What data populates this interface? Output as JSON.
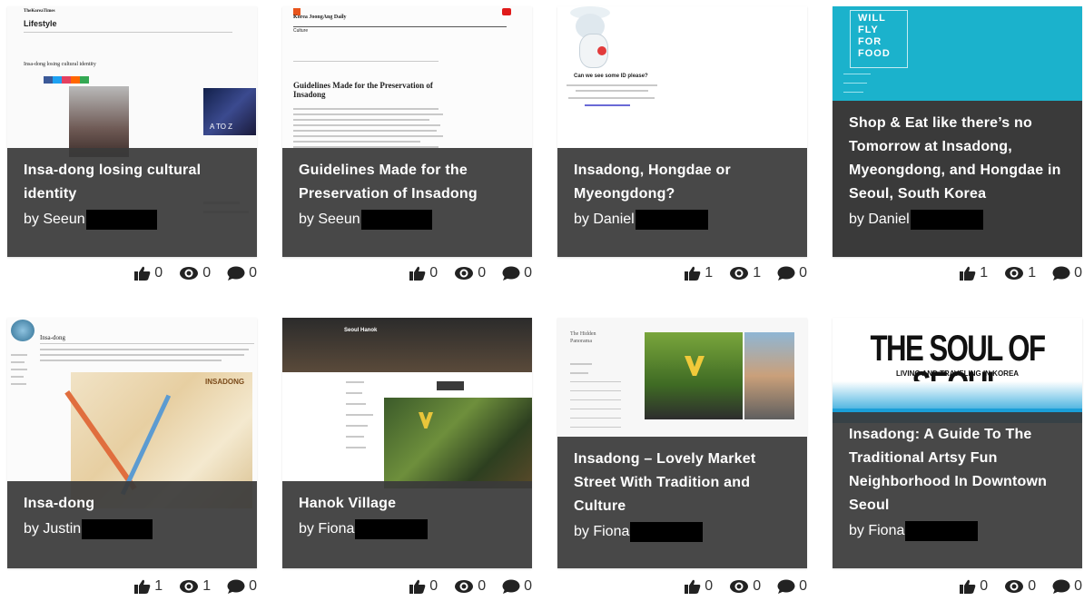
{
  "cards": [
    {
      "title": "Insa-dong losing cultural identity",
      "author": "by Seeun",
      "likes": "0",
      "views": "0",
      "comments": "0",
      "thumb": {
        "site_name": "TheKoreaTimes",
        "section": "Lifestyle",
        "headline": "Insa-dong losing cultural identity",
        "ad_text": "A TO Z"
      }
    },
    {
      "title": "Guidelines Made for the Preservation of Insadong",
      "author": "by Seeun",
      "likes": "0",
      "views": "0",
      "comments": "0",
      "thumb": {
        "site_name": "Korea JoongAng Daily",
        "section": "Culture",
        "headline": "Guidelines Made for the Preservation of Insadong"
      }
    },
    {
      "title": "Insadong, Hongdae or Myeongdong?",
      "author": "by Daniel",
      "likes": "1",
      "views": "1",
      "comments": "0",
      "thumb": {
        "prompt": "Can we see some ID please?"
      }
    },
    {
      "title": "Shop & Eat like there’s no Tomorrow at Insadong, Myeongdong, and Hongdae in Seoul, South Korea",
      "author": "by Daniel",
      "likes": "1",
      "views": "1",
      "comments": "0",
      "thumb": {
        "logo_lines": [
          "WILL",
          "FLY",
          "FOR",
          "FOOD"
        ]
      }
    },
    {
      "title": "Insa-dong",
      "author": "by Justin",
      "likes": "1",
      "views": "1",
      "comments": "0",
      "thumb": {
        "headline": "Insa-dong",
        "map_label": "INSADONG"
      }
    },
    {
      "title": "Hanok Village",
      "author": "by Fiona",
      "likes": "0",
      "views": "0",
      "comments": "0",
      "thumb": {
        "site_name": "Seoul Hanok"
      }
    },
    {
      "title": "Insadong – Lovely Market Street With Tradition and Culture",
      "author": "by Fiona",
      "likes": "0",
      "views": "0",
      "comments": "0",
      "thumb": {
        "site_name": "The Hidden Panorama"
      }
    },
    {
      "title": "Insadong: A Guide To The Traditional Artsy Fun Neighborhood In Downtown Seoul",
      "author": "by Fiona",
      "likes": "0",
      "views": "0",
      "comments": "0",
      "thumb": {
        "banner_title": "THE SOUL OF SEOUL",
        "banner_sub": "LIVING AND TRAVELING IN KOREA"
      }
    }
  ],
  "colors": {
    "overlay": "#3a3a3a",
    "redaction": "#000000",
    "teal_banner": "#1bb2cc",
    "sky_banner": "#1a9fd8"
  },
  "icons": [
    "thumbs-up-icon",
    "eye-icon",
    "comment-icon"
  ]
}
